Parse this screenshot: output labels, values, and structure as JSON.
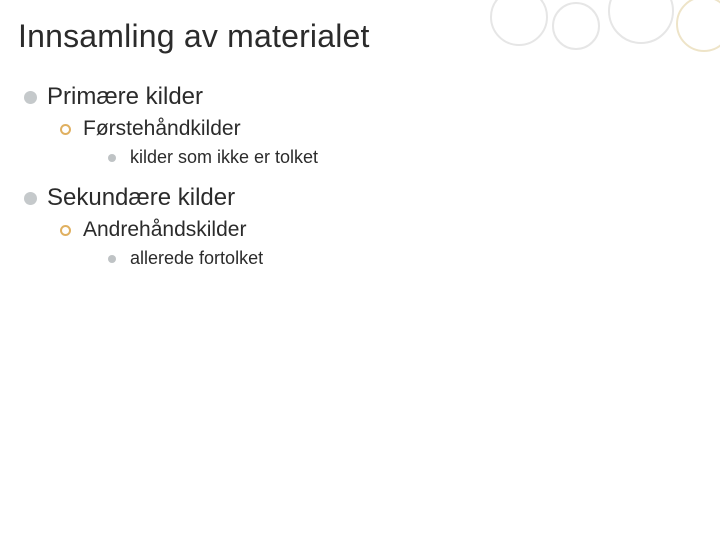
{
  "title": "Innsamling av materialet",
  "items": [
    {
      "level": 1,
      "text": "Primære kilder"
    },
    {
      "level": 2,
      "text": "Førstehåndkilder"
    },
    {
      "level": 3,
      "text": "kilder som ikke er tolket"
    },
    {
      "level": 1,
      "text": "Sekundære kilder"
    },
    {
      "level": 2,
      "text": "Andrehåndskilder"
    },
    {
      "level": 3,
      "text": "allerede fortolket"
    }
  ]
}
